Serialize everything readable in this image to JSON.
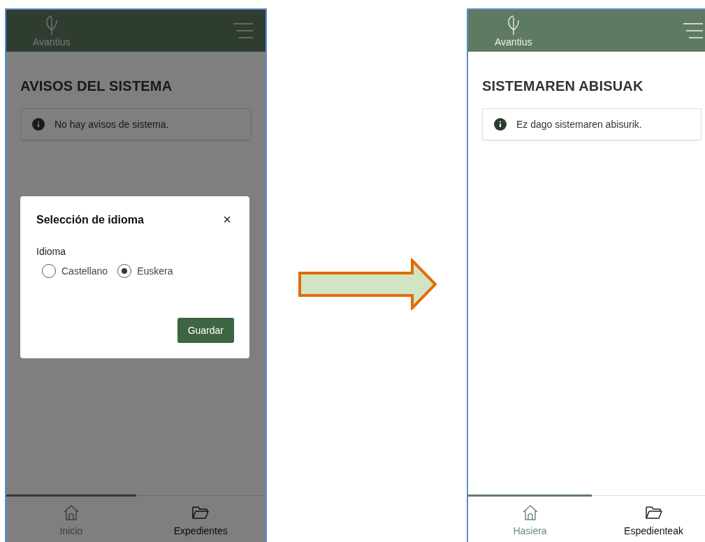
{
  "screens": [
    {
      "header": {
        "logo_text": "Avantius"
      },
      "title": "AVISOS DEL SISTEMA",
      "notice": "No hay avisos de sistema.",
      "dimmed": true,
      "dialog": {
        "title": "Selección de idioma",
        "close": "×",
        "field_label": "Idioma",
        "options": [
          {
            "label": "Castellano",
            "selected": false
          },
          {
            "label": "Euskera",
            "selected": true
          }
        ],
        "button": "Guardar"
      },
      "nav": [
        {
          "kind": "home",
          "label": "Inicio",
          "selected": true
        },
        {
          "kind": "folder",
          "label": "Expedientes",
          "selected": false
        }
      ]
    },
    {
      "header": {
        "logo_text": "Avantius"
      },
      "title": "SISTEMAREN ABISUAK",
      "notice": "Ez dago sistemaren abisurik.",
      "dimmed": false,
      "nav": [
        {
          "kind": "home",
          "label": "Hasiera",
          "selected": true
        },
        {
          "kind": "folder",
          "label": "Espedienteak",
          "selected": false
        }
      ]
    }
  ]
}
